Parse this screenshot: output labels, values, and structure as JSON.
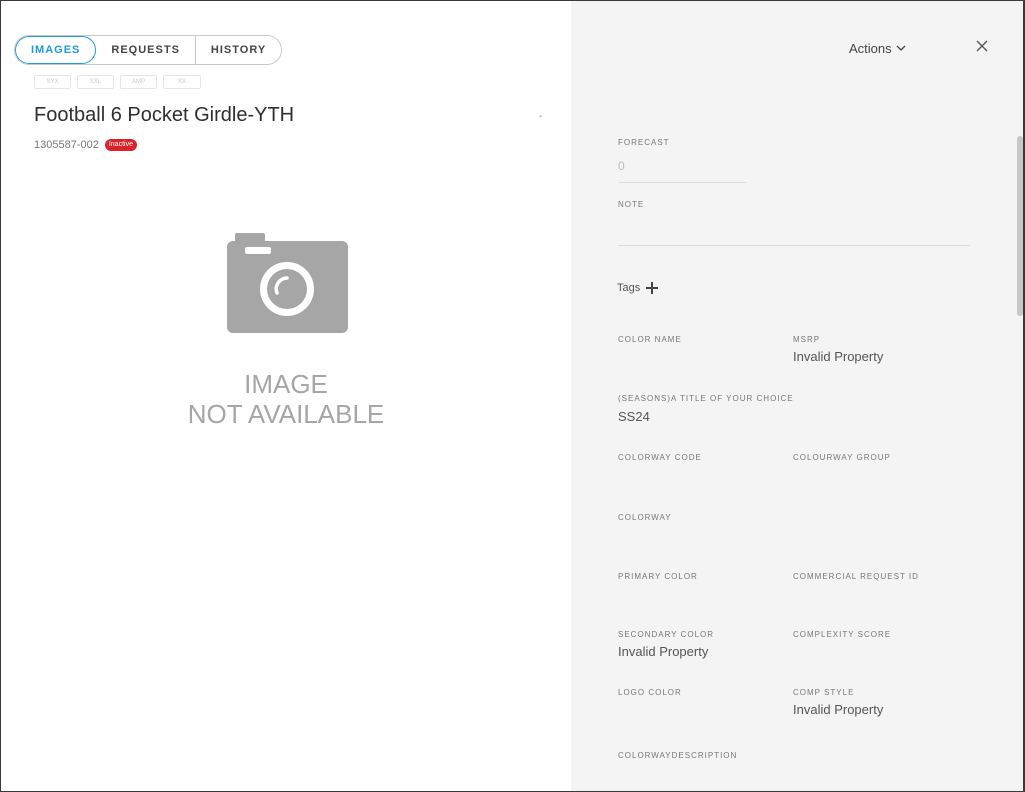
{
  "tabs": [
    {
      "label": "IMAGES",
      "active": true
    },
    {
      "label": "REQUESTS",
      "active": false
    },
    {
      "label": "HISTORY",
      "active": false
    }
  ],
  "size_chips": [
    "SYX",
    "SXL",
    "AMP",
    "XX"
  ],
  "product": {
    "title": "Football 6 Pocket Girdle-YTH",
    "dash": "-",
    "sku": "1305587-002",
    "status": "Inactive"
  },
  "image_placeholder": {
    "line1": "IMAGE",
    "line2": "NOT AVAILABLE",
    "icon": "camera-icon"
  },
  "header": {
    "actions_label": "Actions",
    "actions_icon": "chevron-down-icon",
    "close_icon": "close-icon"
  },
  "fields": {
    "forecast": {
      "label": "FORECAST",
      "placeholder": "0"
    },
    "note": {
      "label": "NOTE"
    },
    "tags_label": "Tags",
    "color_name": {
      "label": "COLOR NAME",
      "value": ""
    },
    "msrp": {
      "label": "MSRP",
      "value": "Invalid Property"
    },
    "seasons": {
      "label": "(SEASONS)A TITLE OF YOUR CHOICE",
      "value": "SS24"
    },
    "colorway_code": {
      "label": "COLORWAY CODE",
      "value": ""
    },
    "colourway_group": {
      "label": "COLOURWAY GROUP",
      "value": ""
    },
    "colorway": {
      "label": "COLORWAY",
      "value": ""
    },
    "primary_color": {
      "label": "PRIMARY COLOR",
      "value": ""
    },
    "commercial_request_id": {
      "label": "COMMERCIAL REQUEST ID",
      "value": ""
    },
    "secondary_color": {
      "label": "SECONDARY COLOR",
      "value": "Invalid Property"
    },
    "complexity_score": {
      "label": "COMPLEXITY SCORE",
      "value": ""
    },
    "logo_color": {
      "label": "LOGO COLOR",
      "value": ""
    },
    "comp_style": {
      "label": "COMP STYLE",
      "value": "Invalid Property"
    },
    "colorwaydescription": {
      "label": "COLORWAYDESCRIPTION",
      "value": ""
    }
  },
  "colors": {
    "accent": "#1e9bd6",
    "badge": "#d9242b",
    "panel_bg": "#f4f4f4"
  }
}
